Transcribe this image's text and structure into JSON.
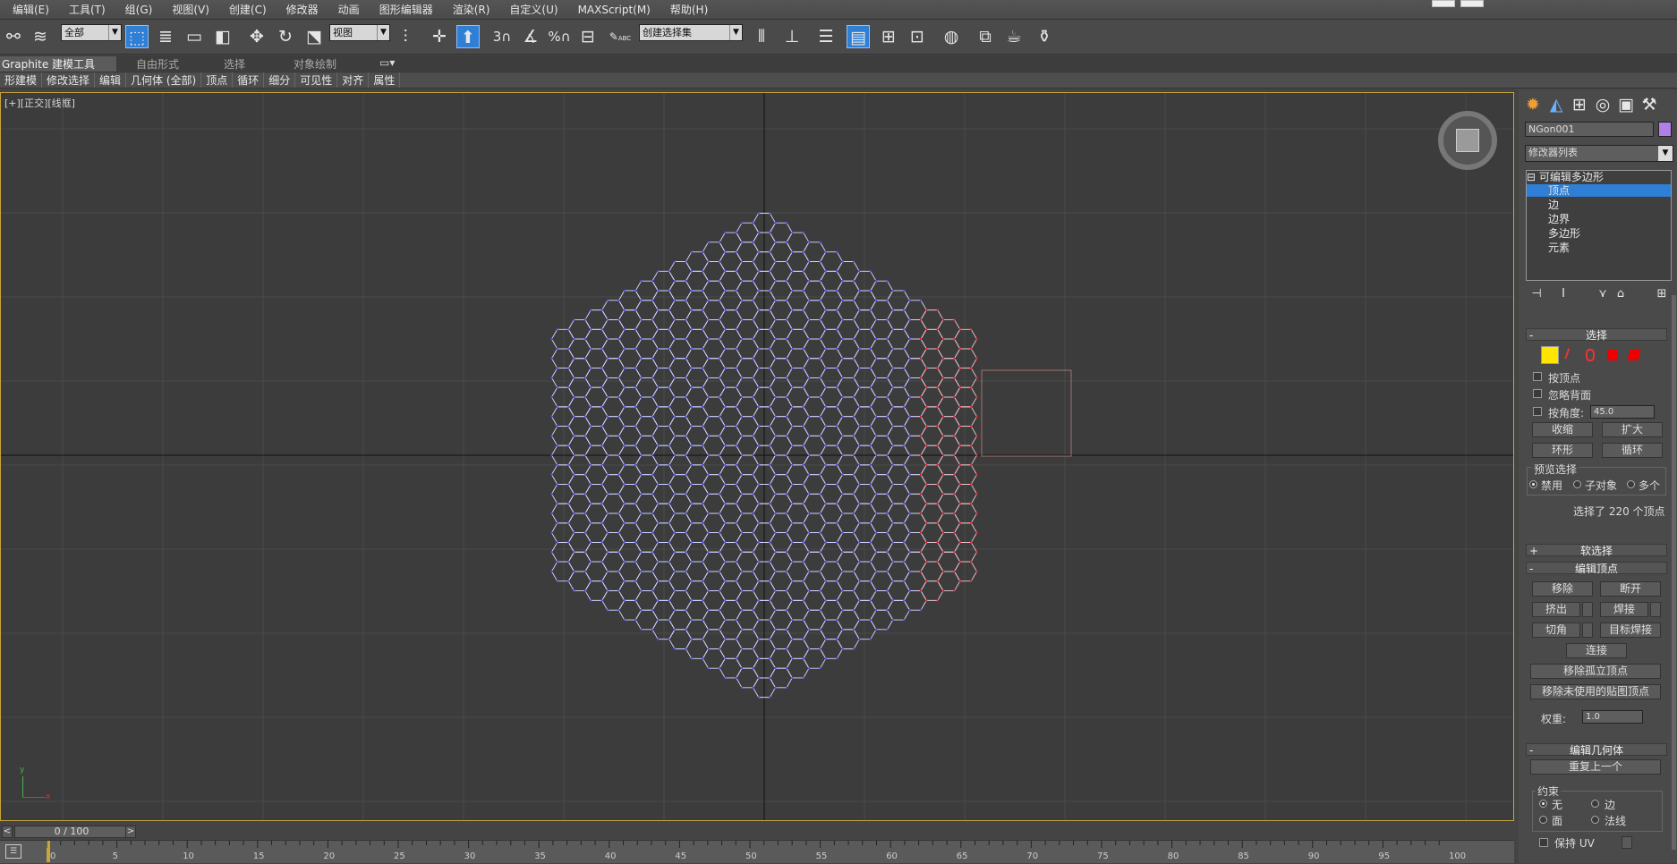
{
  "menu": [
    "编辑(E)",
    "工具(T)",
    "组(G)",
    "视图(V)",
    "创建(C)",
    "修改器",
    "动画",
    "图形编辑器",
    "渲染(R)",
    "自定义(U)",
    "MAXScript(M)",
    "帮助(H)"
  ],
  "toolbar": {
    "selection_filter": "全部",
    "ref_coord": "视图",
    "named_selection": "创建选择集",
    "snap_3": "3",
    "percent_snap": "%",
    "abc_label": "ABC"
  },
  "ribbon": {
    "tabs": [
      "Graphite 建模工具",
      "自由形式",
      "选择",
      "对象绘制"
    ]
  },
  "subbar": [
    "形建模",
    "修改选择",
    "编辑",
    "几何体 (全部)",
    "顶点",
    "循环",
    "细分",
    "可见性",
    "对齐",
    "属性"
  ],
  "viewport": {
    "label": "[+][正交][线框]",
    "axis_y": "y",
    "axis_x": "x"
  },
  "timeline": {
    "frame": "0 / 100",
    "prev": "<",
    "next": ">"
  },
  "ruler_ticks": [
    "0",
    "5",
    "10",
    "15",
    "20",
    "25",
    "30",
    "35",
    "40",
    "45",
    "50",
    "55",
    "60",
    "65",
    "70",
    "75",
    "80",
    "85",
    "90",
    "95",
    "100"
  ],
  "right_panel": {
    "object_name": "NGon001",
    "modifier_list": "修改器列表",
    "stack": [
      "可编辑多边形",
      "顶点",
      "边",
      "边界",
      "多边形",
      "元素"
    ],
    "selection_title": "选择",
    "by_vertex": "按顶点",
    "ignore_backface": "忽略背面",
    "by_angle": "按角度:",
    "angle_value": "45.0",
    "shrink": "收缩",
    "grow": "扩大",
    "ring": "环形",
    "loop": "循环",
    "preview_title": "预览选择",
    "preview_opts": [
      "禁用",
      "子对象",
      "多个"
    ],
    "selected_info": "选择了 220 个顶点",
    "soft_selection": "软选择",
    "edit_vertices": "编辑顶点",
    "remove": "移除",
    "break": "断开",
    "extrude": "挤出",
    "weld": "焊接",
    "chamfer": "切角",
    "target_weld": "目标焊接",
    "connect": "连接",
    "remove_isolated": "移除孤立顶点",
    "remove_unused_map": "移除未使用的贴图顶点",
    "weight_label": "权重:",
    "weight_value": "1.0",
    "edit_geometry": "编辑几何体",
    "repeat_last": "重复上一个",
    "constraints": "约束",
    "constraint_opts": [
      "无",
      "边",
      "面",
      "法线"
    ],
    "preserve_uv": "保持 UV"
  },
  "colors": {
    "accent": "#2f7fd6",
    "selected_vertex": "#ff2020",
    "mesh_edge": "#d8d8ff",
    "vertex": "#5050ff"
  }
}
